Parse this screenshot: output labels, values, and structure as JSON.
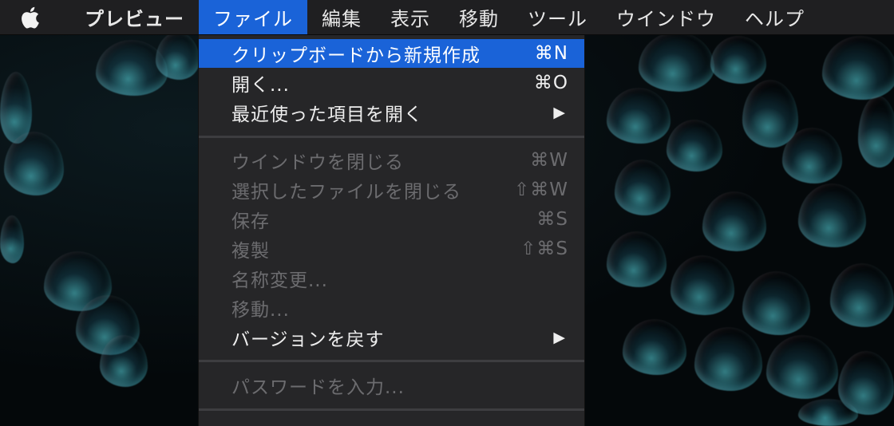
{
  "menubar": {
    "apple_icon": "apple-logo-icon",
    "app_name": "プレビュー",
    "items": [
      {
        "label": "ファイル",
        "active": true
      },
      {
        "label": "編集"
      },
      {
        "label": "表示"
      },
      {
        "label": "移動"
      },
      {
        "label": "ツール"
      },
      {
        "label": "ウインドウ"
      },
      {
        "label": "ヘルプ"
      }
    ]
  },
  "file_menu": {
    "items": [
      {
        "label": "クリップボードから新規作成",
        "shortcut": "⌘N",
        "state": "highlighted"
      },
      {
        "label": "開く...",
        "shortcut": "⌘O",
        "state": "enabled"
      },
      {
        "label": "最近使った項目を開く",
        "submenu_icon": "submenu-arrow-icon",
        "state": "enabled"
      },
      {
        "label": "ウインドウを閉じる",
        "shortcut": "⌘W",
        "state": "disabled"
      },
      {
        "label": "選択したファイルを閉じる",
        "shortcut": "⇧⌘W",
        "state": "disabled"
      },
      {
        "label": "保存",
        "shortcut": "⌘S",
        "state": "disabled"
      },
      {
        "label": "複製",
        "shortcut": "⇧⌘S",
        "state": "disabled"
      },
      {
        "label": "名称変更...",
        "state": "disabled"
      },
      {
        "label": "移動...",
        "state": "disabled"
      },
      {
        "label": "バージョンを戻す",
        "submenu_icon": "submenu-arrow-icon",
        "state": "enabled"
      },
      {
        "label": "パスワードを入力...",
        "state": "disabled"
      }
    ],
    "submenu_arrow": "▶"
  },
  "colors": {
    "menubar_bg": "#1f1f21",
    "menu_bg": "#262628",
    "highlight": "#1a63d8",
    "text": "#eeeeee",
    "disabled_text": "#6c6c6f"
  }
}
